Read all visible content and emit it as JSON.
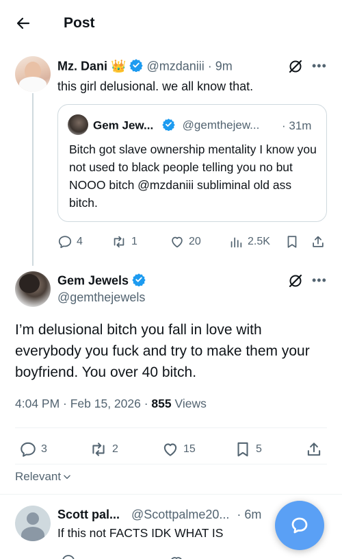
{
  "header": {
    "title": "Post"
  },
  "parent_post": {
    "display_name": "Mz. Dani",
    "handle": "@mzdaniii",
    "time": "· 9m",
    "text": "this girl delusional. we all know that.",
    "quote": {
      "display_name": "Gem Jew...",
      "handle": "@gemthejew...",
      "time": "· 31m",
      "text": "Bitch got slave ownership mentality I know you not used to black people telling you no but NOOO bitch @mzdaniii subliminal old ass bitch."
    },
    "actions": {
      "replies": "4",
      "reposts": "1",
      "likes": "20",
      "views": "2.5K"
    }
  },
  "main_post": {
    "display_name": "Gem Jewels",
    "handle": "@gemthejewels",
    "text": "I’m delusional bitch you fall in love with everybody you fuck and try to make them your boyfriend. You over 40 bitch.",
    "timestamp": "4:04 PM · Feb 15, 2026 · ",
    "views_count": "855",
    "views_label": " Views",
    "actions": {
      "replies": "3",
      "reposts": "2",
      "likes": "15",
      "bookmarks": "5"
    }
  },
  "sort": {
    "label": "Relevant"
  },
  "reply": {
    "display_name": "Scott pal...",
    "handle": "@Scottpalme20...",
    "time": "· 6m",
    "text": "If this not FACTS IDK WHAT IS"
  },
  "colors": {
    "verified": "#1d9bf0",
    "fab": "#5aa0f5",
    "muted": "#536471",
    "border": "#cfd9de"
  }
}
